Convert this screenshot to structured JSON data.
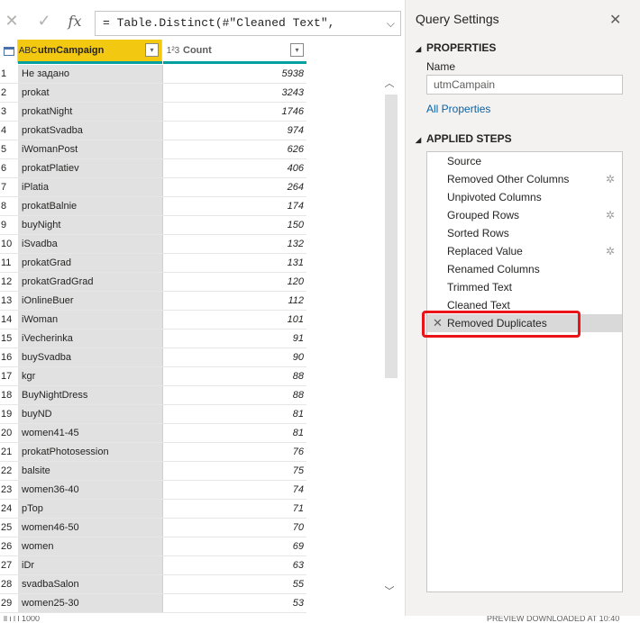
{
  "formula_bar": {
    "cancel_glyph": "✕",
    "ok_glyph": "✓",
    "fx_label": "fx",
    "formula": "= Table.Distinct(#\"Cleaned Text\",",
    "expand_glyph": "⌵"
  },
  "grid": {
    "columns": [
      {
        "type_label": "ABC",
        "name": "utmCampaign"
      },
      {
        "type_label": "1²3",
        "name": "Count"
      }
    ],
    "rows": [
      {
        "n": "1",
        "campaign": "Не задано",
        "count": "5938"
      },
      {
        "n": "2",
        "campaign": "prokat",
        "count": "3243"
      },
      {
        "n": "3",
        "campaign": "prokatNight",
        "count": "1746"
      },
      {
        "n": "4",
        "campaign": "prokatSvadba",
        "count": "974"
      },
      {
        "n": "5",
        "campaign": "iWomanPost",
        "count": "626"
      },
      {
        "n": "6",
        "campaign": "prokatPlatiev",
        "count": "406"
      },
      {
        "n": "7",
        "campaign": "iPlatia",
        "count": "264"
      },
      {
        "n": "8",
        "campaign": "prokatBalnie",
        "count": "174"
      },
      {
        "n": "9",
        "campaign": "buyNight",
        "count": "150"
      },
      {
        "n": "10",
        "campaign": "iSvadba",
        "count": "132"
      },
      {
        "n": "11",
        "campaign": "prokatGrad",
        "count": "131"
      },
      {
        "n": "12",
        "campaign": "prokatGradGrad",
        "count": "120"
      },
      {
        "n": "13",
        "campaign": "iOnlineBuer",
        "count": "112"
      },
      {
        "n": "14",
        "campaign": "iWoman",
        "count": "101"
      },
      {
        "n": "15",
        "campaign": "iVecherinka",
        "count": "91"
      },
      {
        "n": "16",
        "campaign": "buySvadba",
        "count": "90"
      },
      {
        "n": "17",
        "campaign": "kgr",
        "count": "88"
      },
      {
        "n": "18",
        "campaign": "BuyNightDress",
        "count": "88"
      },
      {
        "n": "19",
        "campaign": "buyND",
        "count": "81"
      },
      {
        "n": "20",
        "campaign": "women41-45",
        "count": "81"
      },
      {
        "n": "21",
        "campaign": "prokatPhotosession",
        "count": "76"
      },
      {
        "n": "22",
        "campaign": "balsite",
        "count": "75"
      },
      {
        "n": "23",
        "campaign": "women36-40",
        "count": "74"
      },
      {
        "n": "24",
        "campaign": "pTop",
        "count": "71"
      },
      {
        "n": "25",
        "campaign": "women46-50",
        "count": "70"
      },
      {
        "n": "26",
        "campaign": "women",
        "count": "69"
      },
      {
        "n": "27",
        "campaign": "iDr",
        "count": "63"
      },
      {
        "n": "28",
        "campaign": "svadbaSalon",
        "count": "55"
      },
      {
        "n": "29",
        "campaign": "women25-30",
        "count": "53"
      }
    ]
  },
  "status_bar": {
    "left": "ll i l l 1000",
    "right": "PREVIEW DOWNLOADED AT 10:40"
  },
  "query_settings": {
    "title": "Query Settings",
    "close_glyph": "✕",
    "properties_header": "PROPERTIES",
    "name_label": "Name",
    "name_value": "utmCampain",
    "all_properties_link": "All Properties",
    "applied_steps_header": "APPLIED STEPS",
    "steps": [
      {
        "label": "Source",
        "gear": ""
      },
      {
        "label": "Removed Other Columns",
        "gear": "✲"
      },
      {
        "label": "Unpivoted Columns",
        "gear": ""
      },
      {
        "label": "Grouped Rows",
        "gear": "✲"
      },
      {
        "label": "Sorted Rows",
        "gear": ""
      },
      {
        "label": "Replaced Value",
        "gear": "✲"
      },
      {
        "label": "Renamed Columns",
        "gear": ""
      },
      {
        "label": "Trimmed Text",
        "gear": ""
      },
      {
        "label": "Cleaned Text",
        "gear": ""
      },
      {
        "label": "Removed Duplicates",
        "gear": ""
      }
    ],
    "selected_step_index": 9,
    "highlight_color": "#e8141a"
  }
}
